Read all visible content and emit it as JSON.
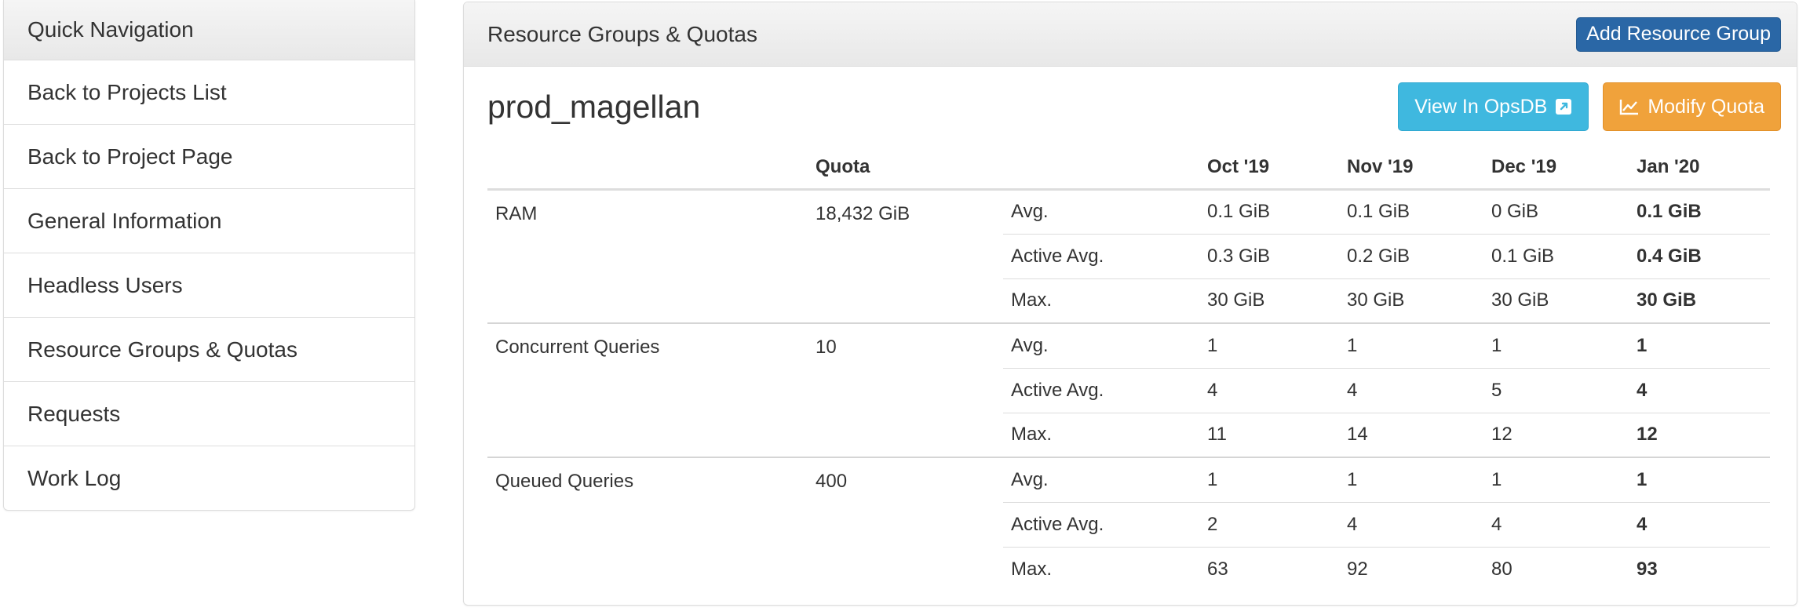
{
  "sidebar": {
    "header": "Quick Navigation",
    "items": [
      {
        "label": "Back to Projects List"
      },
      {
        "label": "Back to Project Page"
      },
      {
        "label": "General Information"
      },
      {
        "label": "Headless Users"
      },
      {
        "label": "Resource Groups & Quotas"
      },
      {
        "label": "Requests"
      },
      {
        "label": "Work Log"
      }
    ]
  },
  "panel": {
    "title": "Resource Groups & Quotas",
    "add_button": "Add Resource Group",
    "project_name": "prod_magellan",
    "view_button": "View In OpsDB",
    "modify_button": "Modify Quota"
  },
  "table": {
    "headers": [
      "",
      "Quota",
      "",
      "Oct '19",
      "Nov '19",
      "Dec '19",
      "Jan '20"
    ],
    "groups": [
      {
        "name": "RAM",
        "quota": "18,432 GiB",
        "rows": [
          {
            "stat": "Avg.",
            "values": [
              "0.1 GiB",
              "0.1 GiB",
              "0 GiB",
              "0.1 GiB"
            ]
          },
          {
            "stat": "Active Avg.",
            "values": [
              "0.3 GiB",
              "0.2 GiB",
              "0.1 GiB",
              "0.4 GiB"
            ]
          },
          {
            "stat": "Max.",
            "values": [
              "30 GiB",
              "30 GiB",
              "30 GiB",
              "30 GiB"
            ]
          }
        ]
      },
      {
        "name": "Concurrent Queries",
        "quota": "10",
        "rows": [
          {
            "stat": "Avg.",
            "values": [
              "1",
              "1",
              "1",
              "1"
            ]
          },
          {
            "stat": "Active Avg.",
            "values": [
              "4",
              "4",
              "5",
              "4"
            ]
          },
          {
            "stat": "Max.",
            "values": [
              "11",
              "14",
              "12",
              "12"
            ]
          }
        ]
      },
      {
        "name": "Queued Queries",
        "quota": "400",
        "rows": [
          {
            "stat": "Avg.",
            "values": [
              "1",
              "1",
              "1",
              "1"
            ]
          },
          {
            "stat": "Active Avg.",
            "values": [
              "2",
              "4",
              "4",
              "4"
            ]
          },
          {
            "stat": "Max.",
            "values": [
              "63",
              "92",
              "80",
              "93"
            ]
          }
        ]
      }
    ]
  },
  "colors": {
    "primary": "#2a67a6",
    "info": "#3fb8df",
    "warning": "#f0a23b"
  }
}
